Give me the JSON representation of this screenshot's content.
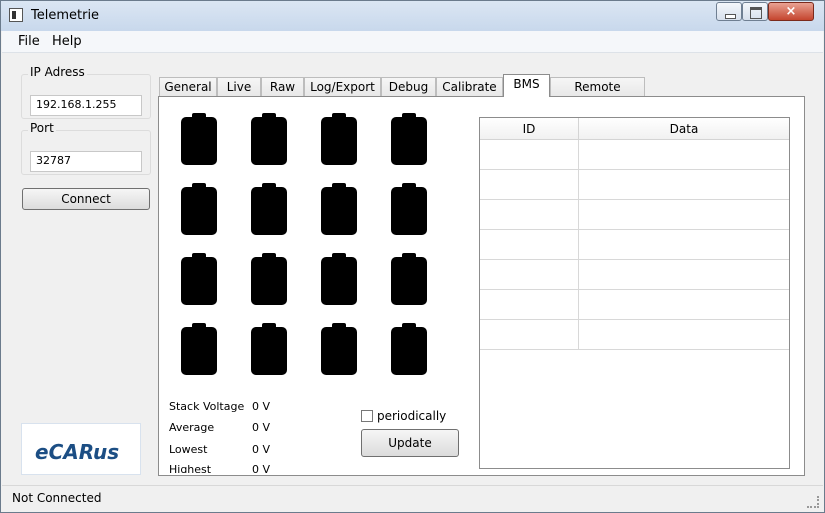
{
  "window": {
    "title": "Telemetrie",
    "close": "×"
  },
  "menu": {
    "file": "File",
    "help": "Help"
  },
  "connection": {
    "ip_label": "IP Adress",
    "ip_value": "192.168.1.255",
    "port_label": "Port",
    "port_value": "32787",
    "connect_label": "Connect"
  },
  "logo": {
    "text": "eCARus"
  },
  "tabs": [
    "General",
    "Live",
    "Raw",
    "Log/Export",
    "Debug",
    "Calibrate",
    "BMS",
    "Remote Control"
  ],
  "active_tab": "BMS",
  "bms": {
    "cells": [
      "",
      "",
      "",
      "",
      "",
      "",
      "",
      "",
      "",
      "",
      "",
      "",
      "",
      "",
      "",
      ""
    ],
    "stats": [
      {
        "label": "Stack Voltage",
        "value": "0 V"
      },
      {
        "label": "Average",
        "value": "0 V"
      },
      {
        "label": "Lowest",
        "value": "0 V"
      },
      {
        "label": "Highest",
        "value": "0 V"
      }
    ],
    "periodically_label": "periodically",
    "periodically_checked": false,
    "update_label": "Update"
  },
  "table": {
    "columns": [
      "ID",
      "Data"
    ],
    "rows": [
      {
        "id": "",
        "data": ""
      },
      {
        "id": "",
        "data": ""
      },
      {
        "id": "",
        "data": ""
      },
      {
        "id": "",
        "data": ""
      },
      {
        "id": "",
        "data": ""
      },
      {
        "id": "",
        "data": ""
      },
      {
        "id": "",
        "data": ""
      }
    ]
  },
  "status": {
    "text": "Not Connected"
  },
  "colors": {
    "accent": "#1c4e84",
    "battery": "#000000",
    "close_button": "#c4452e"
  }
}
